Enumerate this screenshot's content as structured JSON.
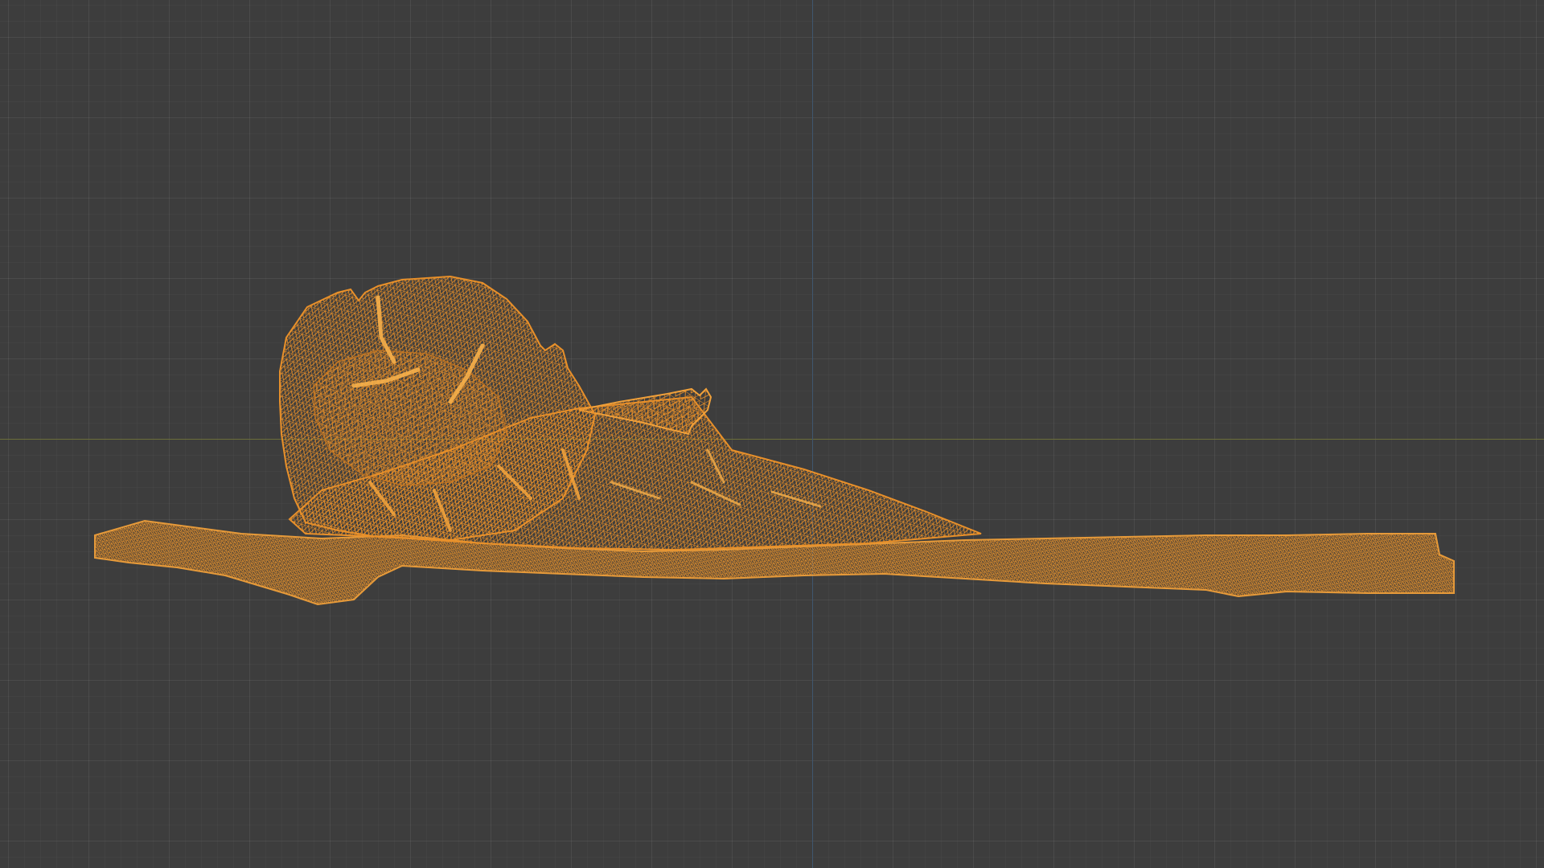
{
  "viewport": {
    "background_color": "#3d3d3d",
    "grid_color": "#474747",
    "x_axis_color": "#6b6e3a",
    "y_axis_color": "#3f566e",
    "object": {
      "display_mode": "wireframe",
      "selected": true,
      "wire_color": "#e8902a",
      "highlight_color": "#f5a43c"
    }
  }
}
